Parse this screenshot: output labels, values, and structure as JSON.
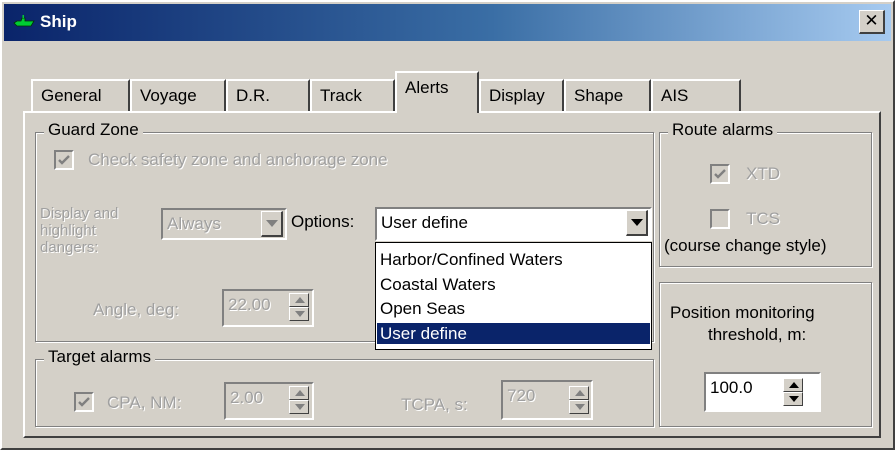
{
  "window": {
    "title": "Ship",
    "close_glyph": "✕"
  },
  "tabs": [
    {
      "label": "General"
    },
    {
      "label": "Voyage"
    },
    {
      "label": "D.R."
    },
    {
      "label": "Track"
    },
    {
      "label": "Alerts"
    },
    {
      "label": "Display"
    },
    {
      "label": "Shape"
    },
    {
      "label": "AIS"
    }
  ],
  "active_tab": "Alerts",
  "guard_zone": {
    "group_label": "Guard Zone",
    "check_label": "Check safety zone and anchorage zone",
    "checked": true,
    "display_label_1": "Display and",
    "display_label_2": "highlight",
    "display_label_3": "dangers:",
    "display_value": "Always",
    "options_label": "Options:",
    "options_value": "User define",
    "options_list": [
      "Harbor/Confined Waters",
      "Coastal Waters",
      "Open Seas",
      "User define"
    ],
    "options_selected": "User define",
    "angle_label": "Angle, deg:",
    "angle_value": "22.00"
  },
  "target_alarms": {
    "group_label": "Target alarms",
    "cpa_label": "CPA, NM:",
    "cpa_checked": true,
    "cpa_value": "2.00",
    "tcpa_label": "TCPA, s:",
    "tcpa_value": "720"
  },
  "route_alarms": {
    "group_label": "Route alarms",
    "xtd_label": "XTD",
    "xtd_checked": true,
    "tcs_label": "TCS",
    "tcs_checked": false,
    "tcs_sublabel": "(course change style)"
  },
  "position_monitoring": {
    "label_1": "Position monitoring",
    "label_2": "threshold, m:",
    "value": "100.0"
  },
  "colors": {
    "titlebar_start": "#0a246a",
    "titlebar_end": "#a6caf0",
    "face": "#d4d0c8",
    "selection": "#0a246a",
    "ship_icon": "#00cc33"
  }
}
